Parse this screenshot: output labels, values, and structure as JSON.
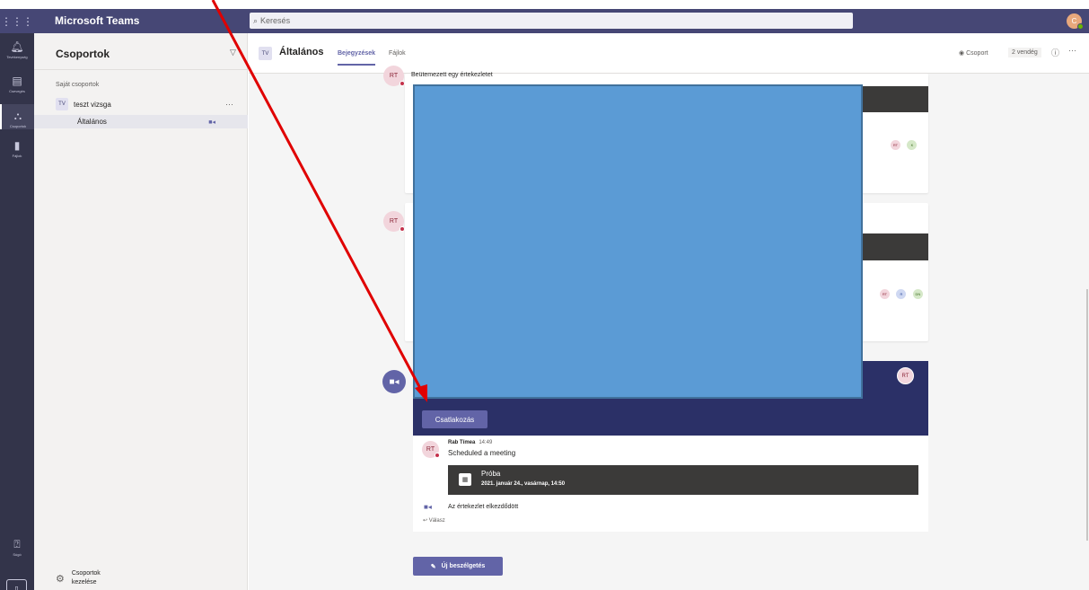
{
  "topbar": {
    "waffle_icon": "⋮⋮⋮",
    "app_name": "Microsoft Teams",
    "search_placeholder": "Keresés",
    "user_initial": "C"
  },
  "rail": {
    "items": [
      {
        "label": "Tevékenység",
        "icon": "bell-icon"
      },
      {
        "label": "Csevegés",
        "icon": "chat-icon"
      },
      {
        "label": "Csoportok",
        "icon": "teams-icon"
      },
      {
        "label": "Fájlok",
        "icon": "files-icon"
      }
    ],
    "help_label": "Súgó"
  },
  "teams_panel": {
    "title": "Csoportok",
    "section_label": "Saját csoportok",
    "team": {
      "badge": "TV",
      "name": "teszt vizsga",
      "more": "···"
    },
    "channel": {
      "name": "Általános"
    },
    "manage_label": "Csoportok kezelése"
  },
  "channel_header": {
    "badge": "TV",
    "title": "Általános",
    "tabs": [
      "Bejegyzések",
      "Fájlok"
    ],
    "team_label": "Csoport",
    "guests_label": "2 vendég",
    "info": "ⓘ",
    "more": "···"
  },
  "conversation": {
    "preview_text": "Beütemezett egy értekezletet",
    "avatar_initials": "RT",
    "mini_avatars_1": [
      "RT",
      "K"
    ],
    "mini_avatars_2": [
      "RT",
      "R",
      "DN"
    ],
    "join_button": "Csatlakozás",
    "banner_avatar": "RT",
    "message": {
      "sender": "Rab Tímea",
      "time": "14:49",
      "text": "Scheduled a meeting",
      "event_title": "Próba",
      "event_date": "2021. január 24., vasárnap, 14:50",
      "started_text": "Az értekezlet elkezdődött",
      "reply_label": "Válasz"
    },
    "new_conversation_button": "Új beszélgetés"
  },
  "colors": {
    "topbar": "#464775",
    "rail": "#33344a",
    "accent": "#6264a7",
    "banner": "#2b3067",
    "overlay": "#5b9bd5",
    "arrow": "#e00000"
  }
}
